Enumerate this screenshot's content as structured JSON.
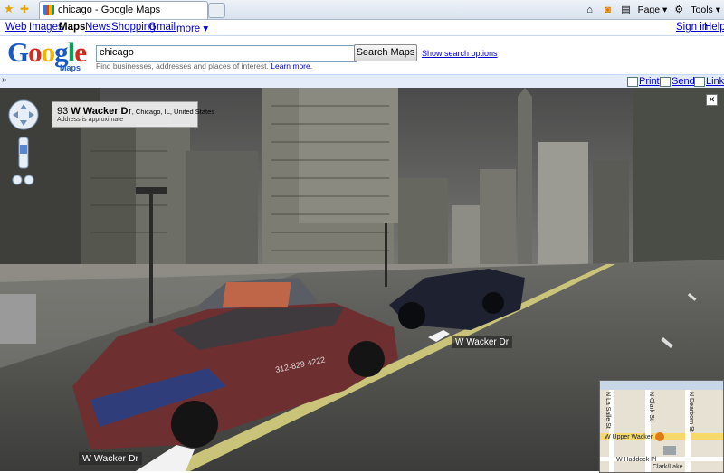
{
  "browser": {
    "tab_title": "chicago - Google Maps",
    "tools": {
      "page": "Page ▾",
      "tools": "Tools ▾"
    }
  },
  "gbar": {
    "links": [
      "Web",
      "Images",
      "Maps",
      "News",
      "Shopping",
      "Gmail",
      "more ▾"
    ],
    "active": "Maps",
    "sign_in": "Sign in",
    "help": "Help"
  },
  "header": {
    "logo_text": "Google",
    "logo_sub": "Maps",
    "search_value": "chicago",
    "hint": "Find businesses, addresses and places of interest.",
    "learn_more": "Learn more.",
    "search_button": "Search Maps",
    "show_options": "Show search options"
  },
  "toolbar": {
    "print": "Print",
    "send": "Send",
    "link": "Link"
  },
  "streetview": {
    "address_number": "93",
    "address_street": "W Wacker Dr",
    "address_city": ", Chicago, IL, United States",
    "address_note": "Address is approximate",
    "street_label_center": "W Wacker Dr",
    "street_label_bottom": "W Wacker Dr",
    "taxi_number": "312-829-4222"
  },
  "minimap": {
    "labels": [
      "N La Salle St",
      "N Clark St",
      "N Dearborn St",
      "W Upper Wacker",
      "W Haddock Pl",
      "Clark/Lake"
    ]
  },
  "colors": {
    "link": "#0000cc",
    "toolbar_bg": "#e5ecf9",
    "street_line": "#c9c47a"
  }
}
